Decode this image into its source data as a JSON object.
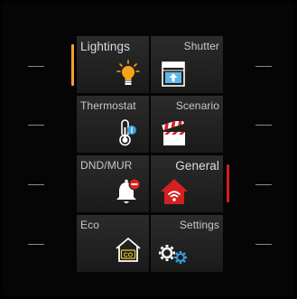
{
  "tiles": [
    {
      "label": "Lightings",
      "icon": "bulb-icon"
    },
    {
      "label": "Shutter",
      "icon": "shutter-icon"
    },
    {
      "label": "Thermostat",
      "icon": "thermometer-icon"
    },
    {
      "label": "Scenario",
      "icon": "clapperboard-icon"
    },
    {
      "label": "DND/MUR",
      "icon": "bell-dnd-icon"
    },
    {
      "label": "General",
      "icon": "home-wifi-icon"
    },
    {
      "label": "Eco",
      "icon": "co2-home-icon"
    },
    {
      "label": "Settings",
      "icon": "gears-icon"
    }
  ],
  "colors": {
    "accent_orange": "#f0a030",
    "accent_red": "#d42020",
    "bulb": "#f7a21b",
    "shutter": "#5bb8e8",
    "gear_blue": "#3aa0e0",
    "alert_red": "#e02020",
    "co2_yellow": "#e8d020"
  }
}
